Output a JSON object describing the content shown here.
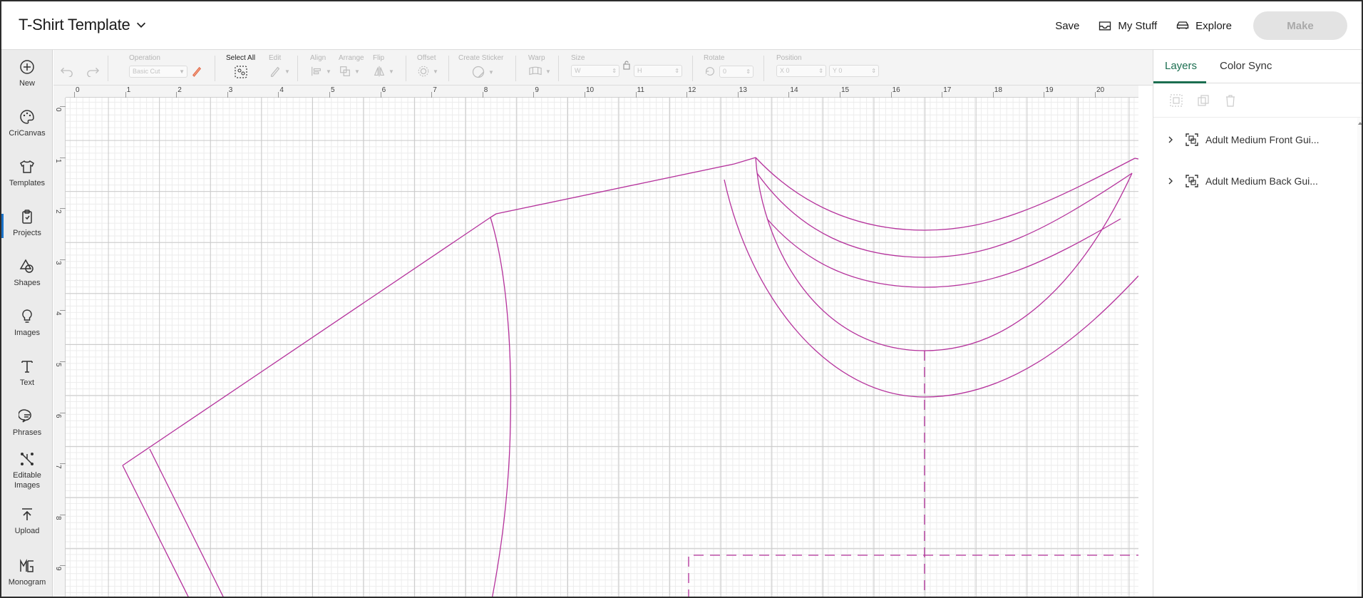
{
  "header": {
    "title": "T-Shirt Template",
    "save_label": "Save",
    "mystuff_label": "My Stuff",
    "explore_label": "Explore",
    "make_label": "Make"
  },
  "sidebar": {
    "items": [
      {
        "label": "New",
        "icon": "plus-circle-icon"
      },
      {
        "label": "CriCanvas",
        "icon": "palette-icon"
      },
      {
        "label": "Templates",
        "icon": "tshirt-icon"
      },
      {
        "label": "Projects",
        "icon": "clipboard-icon"
      },
      {
        "label": "Shapes",
        "icon": "shapes-icon"
      },
      {
        "label": "Images",
        "icon": "lightbulb-icon"
      },
      {
        "label": "Text",
        "icon": "text-icon"
      },
      {
        "label": "Phrases",
        "icon": "speech-bubble-icon"
      },
      {
        "label": "Editable Images",
        "icon": "editable-image-icon"
      },
      {
        "label": "Upload",
        "icon": "upload-icon"
      },
      {
        "label": "Monogram",
        "icon": "monogram-icon"
      }
    ]
  },
  "toolbar": {
    "operation_label": "Operation",
    "operation_value": "Basic Cut",
    "select_all_label": "Select All",
    "edit_label": "Edit",
    "align_label": "Align",
    "arrange_label": "Arrange",
    "flip_label": "Flip",
    "offset_label": "Offset",
    "create_sticker_label": "Create Sticker",
    "warp_label": "Warp",
    "size_label": "Size",
    "size_w": "W",
    "size_h": "H",
    "rotate_label": "Rotate",
    "rotate_value": "0",
    "position_label": "Position",
    "pos_x": "X",
    "pos_x_val": "0",
    "pos_y": "Y",
    "pos_y_val": "0"
  },
  "canvas": {
    "ruler_top": [
      "0",
      "1",
      "2",
      "3",
      "4",
      "5",
      "6",
      "7",
      "8",
      "9",
      "10",
      "11",
      "12",
      "13",
      "14",
      "15",
      "16",
      "17",
      "18",
      "19",
      "20"
    ],
    "ruler_left": [
      "0",
      "1",
      "2",
      "3",
      "4",
      "5",
      "6",
      "7",
      "8",
      "9"
    ],
    "line_color": "#b5329c"
  },
  "panel": {
    "tab_layers": "Layers",
    "tab_color_sync": "Color Sync",
    "layers": [
      {
        "name": "Adult Medium Front Gui..."
      },
      {
        "name": "Adult Medium Back Gui..."
      }
    ],
    "accent": "#1b6e50"
  }
}
